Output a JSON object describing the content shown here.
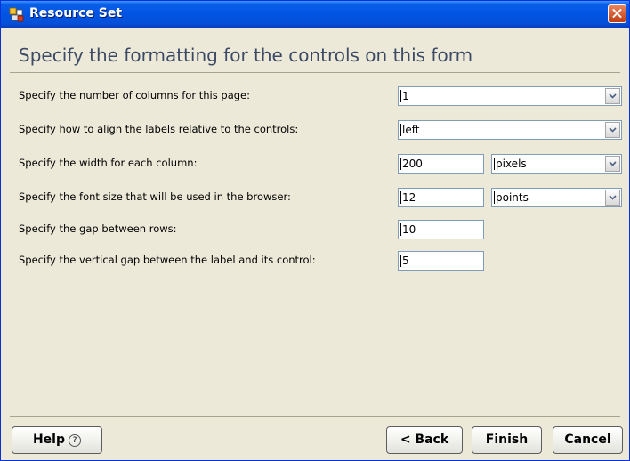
{
  "window": {
    "title": "Resource Set",
    "icon": "resource-set-icon",
    "close_icon": "close-icon"
  },
  "heading": "Specify the formatting for the controls on this form",
  "rows": [
    {
      "label": "Specify the number of columns for this page:",
      "value": "1"
    },
    {
      "label": "Specify how to align the labels relative to the controls:",
      "value": "left"
    },
    {
      "label": "Specify the width for each column:",
      "value": "200",
      "unit": "pixels"
    },
    {
      "label": "Specify the font size that will be used in the browser:",
      "value": "12",
      "unit": "points"
    },
    {
      "label": "Specify the gap between rows:",
      "value": "10"
    },
    {
      "label": "Specify the vertical gap between the label and its control:",
      "value": "5"
    }
  ],
  "buttons": {
    "help": "Help",
    "help_icon": "help-circle-icon",
    "back": "< Back",
    "finish": "Finish",
    "cancel": "Cancel"
  },
  "colors": {
    "titlebar": "#0054e3",
    "panel": "#ece9d8",
    "heading": "#3c4a66",
    "close": "#c13c12"
  }
}
